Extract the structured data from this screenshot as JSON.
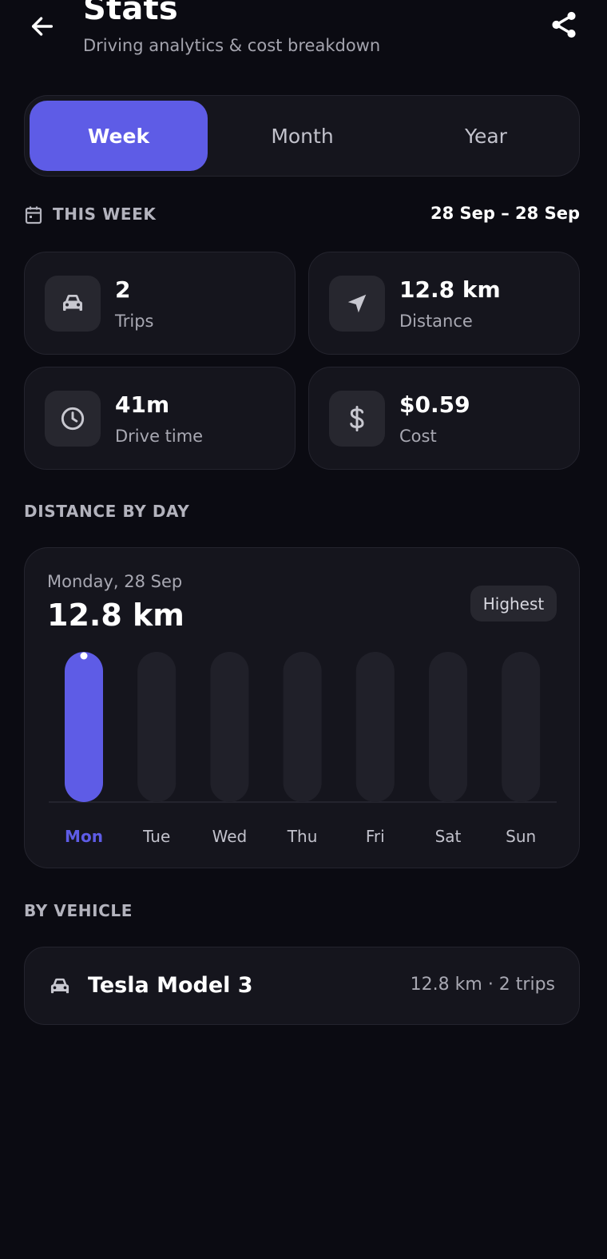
{
  "header": {
    "title": "Stats",
    "subtitle": "Driving analytics & cost breakdown",
    "back_icon": "arrow-left-icon",
    "share_icon": "share-icon"
  },
  "period_tabs": [
    {
      "label": "Week",
      "active": true
    },
    {
      "label": "Month",
      "active": false
    },
    {
      "label": "Year",
      "active": false
    }
  ],
  "period": {
    "label": "THIS WEEK",
    "range": "28 Sep – 28 Sep",
    "icon": "calendar-icon"
  },
  "stats": [
    {
      "value": "2",
      "label": "Trips",
      "icon": "car-icon"
    },
    {
      "value": "12.8 km",
      "label": "Distance",
      "icon": "navigation-arrow-icon"
    },
    {
      "value": "41m",
      "label": "Drive time",
      "icon": "clock-icon"
    },
    {
      "value": "$0.59",
      "label": "Cost",
      "icon": "dollar-icon"
    }
  ],
  "distance_section": {
    "title": "DISTANCE BY DAY",
    "selected_date": "Monday, 28 Sep",
    "selected_value": "12.8 km",
    "badge": "Highest"
  },
  "chart_data": {
    "type": "bar",
    "categories": [
      "Mon",
      "Tue",
      "Wed",
      "Thu",
      "Fri",
      "Sat",
      "Sun"
    ],
    "values": [
      12.8,
      0,
      0,
      0,
      0,
      0,
      0
    ],
    "selected_index": 0,
    "unit": "km",
    "grid": false
  },
  "vehicle_section": {
    "title": "BY VEHICLE",
    "vehicles": [
      {
        "name": "Tesla Model 3",
        "stats": "12.8 km · 2 trips",
        "icon": "car-icon"
      }
    ]
  },
  "colors": {
    "background": "#0b0b12",
    "card": "#15151d",
    "accent": "#5e5ce6",
    "track": "#202029",
    "muted_text": "#a8a8b2"
  }
}
